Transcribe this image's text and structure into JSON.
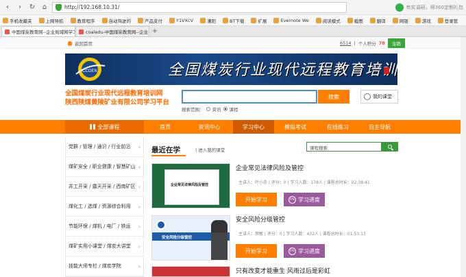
{
  "browser": {
    "url": "http://192.168.10.31/",
    "search_hint": "有实调研，得360定制礼包",
    "bookmarks": [
      "手机收藏夹",
      "上网导航",
      "教育程序",
      "自动驾驶的",
      "产品支付",
      "Y1VXcV",
      "漕阳",
      "BT下载",
      "扩展",
      "Evernote We",
      "阅读模式",
      "截图",
      "翻译",
      "网银",
      "游戏",
      "登录管"
    ],
    "tabs": [
      {
        "label": "中国煤炭教育网--企业局域网学习",
        "active": true
      },
      {
        "label": "coaledu-中国煤炭教育网--企业",
        "active": false
      }
    ]
  },
  "top": {
    "home": "返回首页",
    "user_id": "6514",
    "points_label": "个人积分",
    "points_value": "78",
    "logout": "注销"
  },
  "banner": {
    "logo_text": "CCOEN",
    "title": "全国煤炭行业现代远程教育培训网",
    "signature": "袁纯"
  },
  "org": {
    "line1": "全国煤炭行业现代远程教育培训网",
    "line2": "陕西陕煤黄陵矿业有限公司学习平台"
  },
  "search": {
    "button": "搜索",
    "scope_label": "搜索范围：",
    "opt1": "资讯",
    "opt2": "课程",
    "my_class": "我的课堂"
  },
  "nav": {
    "all_courses": "全部课程",
    "items": [
      "首页",
      "资讯中心",
      "学习中心",
      "模拟考试",
      "在线练习",
      "自主导航"
    ],
    "active_index": 2
  },
  "sidebar": {
    "items": [
      "党群 / 管理 / 通识 / 行业前沿",
      "煤矿安全 / 职业健康 / 智慧矿山",
      "井工开采 / 露天开采 / 西南矿区",
      "煤化工 / 选煤 / 资源综合利用",
      "节能环保 / 煤机 / 电厂 / 铁运",
      "煤矿实用小课堂 / 煤炭大讲堂",
      "技能大师专栏 / 煤炭学院"
    ]
  },
  "main": {
    "recent_title": "最近在学",
    "recent_link": "| 进入我的课堂",
    "course_search_placeholder": "课程搜索",
    "start_label": "开始学习",
    "progress_label": "学习进度",
    "progress_pct": "0%",
    "courses": [
      {
        "title": "企业常见法律风险及管控",
        "thumb_text": "企业常见法律风险及管控",
        "meta": "主讲人：叶小忠  |  评分：0  |  学习人数：178人  |  课程总时长：02:38:41"
      },
      {
        "title": "安全风险分级管控",
        "thumb_text": "安全风险分级管控",
        "meta": "主讲人：贺敏  |  评分：0  |  学习人数：432人  |  课程总时长：01:53:13"
      },
      {
        "title": "只有改变才能重生 风雨过后是彩虹"
      }
    ]
  },
  "colors": {
    "orange": "#ff7e00",
    "green": "#3a9a3a",
    "purple": "#9b5a9b"
  }
}
